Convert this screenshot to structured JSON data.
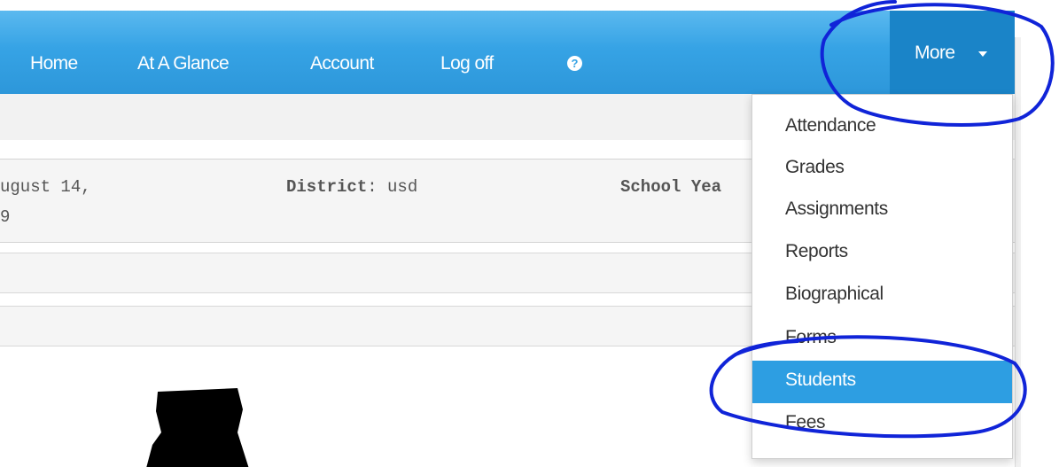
{
  "navbar": {
    "items": [
      {
        "label": "Home"
      },
      {
        "label": "At A Glance"
      },
      {
        "label": "Account"
      },
      {
        "label": "Log off"
      }
    ],
    "help_icon": "question-circle-icon",
    "more_label": "More",
    "more_icon": "caret-down-icon",
    "background_color": "#36a3e5",
    "active_color": "#1a84c8"
  },
  "info": {
    "date_line1": "ugust 14,",
    "date_line2": "9",
    "district_label": "District",
    "district_sep": ":",
    "district_value": "usd",
    "school_year_label": "School Yea"
  },
  "dropdown": {
    "items": [
      {
        "label": "Attendance"
      },
      {
        "label": "Grades"
      },
      {
        "label": "Assignments"
      },
      {
        "label": "Reports"
      },
      {
        "label": "Biographical"
      },
      {
        "label": "Forms"
      },
      {
        "label": "Students"
      },
      {
        "label": "Fees"
      }
    ],
    "active_item": "Students",
    "highlight_color": "#2d9ee2"
  },
  "annotations": {
    "color": "#1024d8"
  }
}
